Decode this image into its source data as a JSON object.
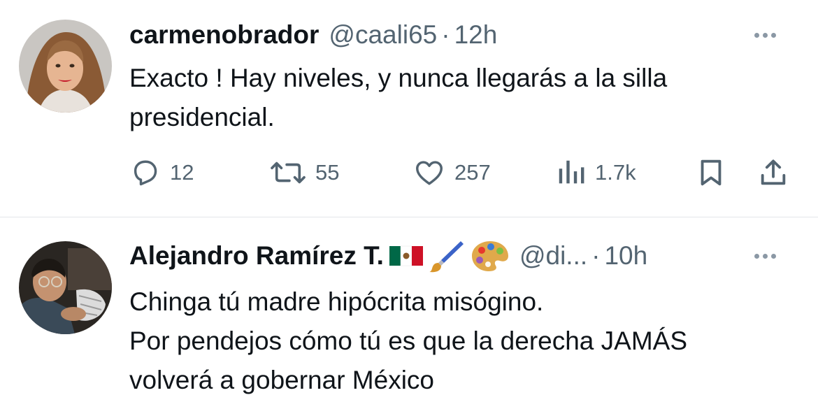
{
  "tweets": [
    {
      "display_name": "carmenobrador",
      "handle": "@caali65",
      "separator": "·",
      "time": "12h",
      "text_lines": [
        "Exacto ! Hay niveles, y nunca llegarás a la silla",
        "presidencial."
      ],
      "actions": {
        "replies": "12",
        "retweets": "55",
        "likes": "257",
        "views": "1.7k"
      }
    },
    {
      "display_name": "Alejandro Ramírez T.",
      "name_emojis": [
        "flag-mexico",
        "paintbrush",
        "artist-palette"
      ],
      "handle": "@di...",
      "separator": "·",
      "time": "10h",
      "text_lines": [
        "Chinga tú madre hipócrita misógino.",
        "Por pendejos cómo tú es que la derecha JAMÁS",
        "volverá a gobernar México"
      ]
    }
  ],
  "icons": {
    "more": "more-horizontal-icon",
    "reply": "reply-icon",
    "retweet": "retweet-icon",
    "like": "heart-icon",
    "views": "views-icon",
    "bookmark": "bookmark-icon",
    "share": "share-icon"
  },
  "colors": {
    "text_primary": "#0f1419",
    "text_secondary": "#536471",
    "divider": "#e3e6ea"
  }
}
